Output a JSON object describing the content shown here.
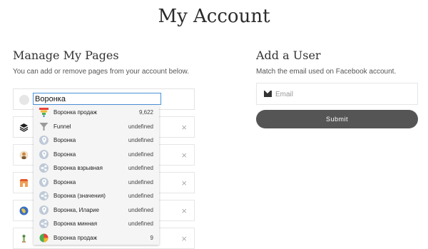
{
  "title": "My Account",
  "manage": {
    "title": "Manage My Pages",
    "subtitle": "You can add or remove pages from your account below.",
    "search_value": "Воронка",
    "rows": [
      {
        "icon": "layers-icon",
        "remove": "×"
      },
      {
        "icon": "person-icon",
        "remove": "×"
      },
      {
        "icon": "store-icon",
        "remove": "×"
      },
      {
        "icon": "globe-icon",
        "remove": "×"
      },
      {
        "icon": "figure-icon",
        "remove": "×"
      }
    ]
  },
  "dropdown": [
    {
      "name": "Воронка продаж",
      "count": "9,622",
      "icon": "funnel-chart-icon"
    },
    {
      "name": "Funnel",
      "count": "undefined",
      "icon": "funnel-icon"
    },
    {
      "name": "Воронка",
      "count": "undefined",
      "icon": "location-pin-icon"
    },
    {
      "name": "Воронка",
      "count": "undefined",
      "icon": "location-pin-icon"
    },
    {
      "name": "Воронка взрывная",
      "count": "undefined",
      "icon": "share-icon"
    },
    {
      "name": "Воронка",
      "count": "undefined",
      "icon": "location-pin-icon"
    },
    {
      "name": "Воронка (значения)",
      "count": "undefined",
      "icon": "share-icon"
    },
    {
      "name": "Воронка, Иларие",
      "count": "undefined",
      "icon": "location-pin-icon"
    },
    {
      "name": "Воронка минная",
      "count": "undefined",
      "icon": "share-icon"
    },
    {
      "name": "Воронка продаж",
      "count": "9",
      "icon": "funnel-chart-icon"
    }
  ],
  "add_user": {
    "title": "Add a User",
    "subtitle": "Match the email used on Facebook account.",
    "email_placeholder": "Email",
    "submit_label": "Submit"
  },
  "colors": {
    "submit_bg": "#555555",
    "focus_border": "#4a90d9"
  }
}
